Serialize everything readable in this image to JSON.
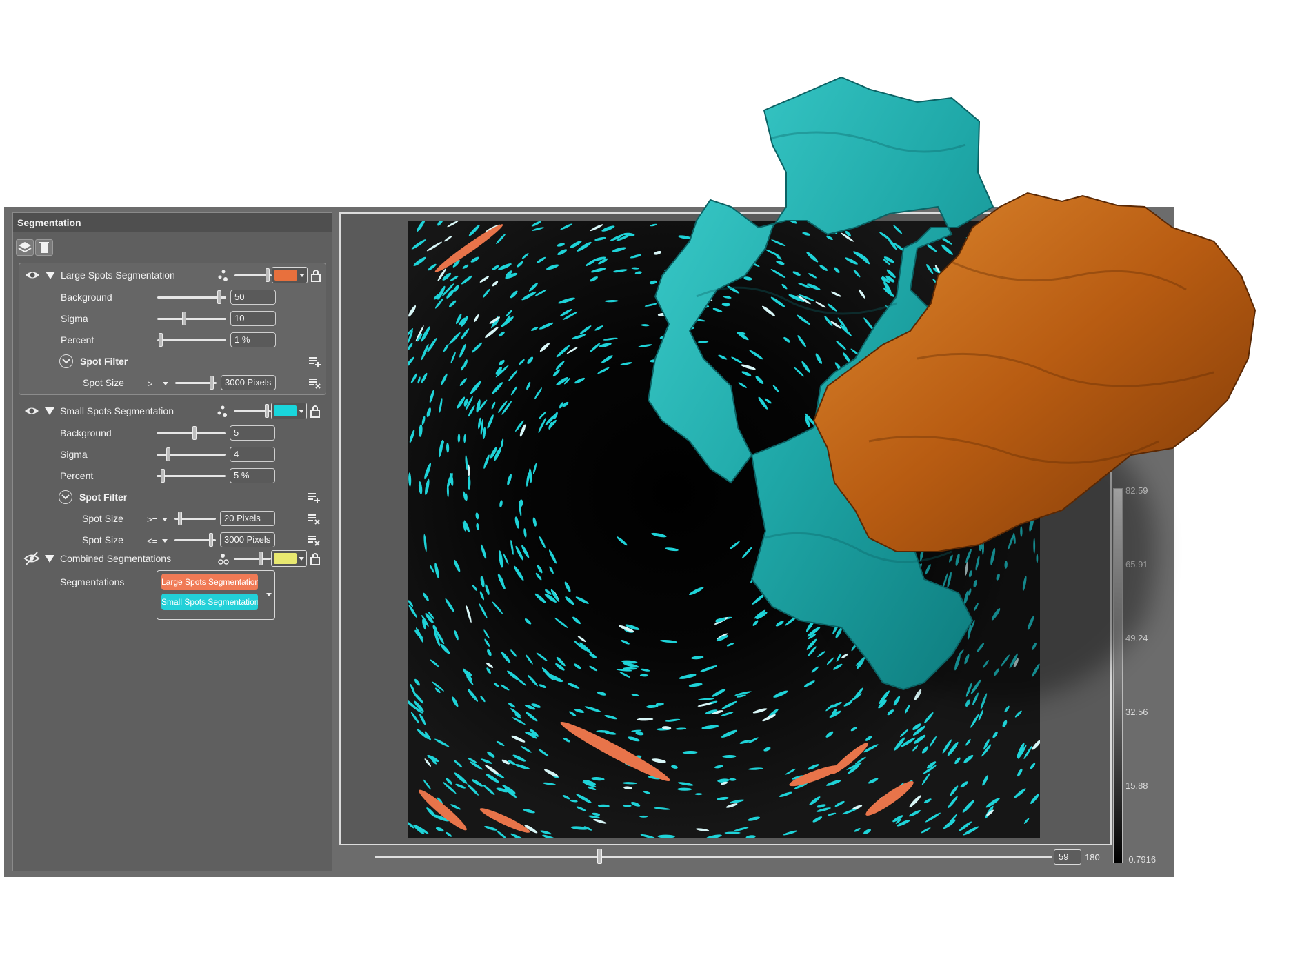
{
  "panel": {
    "title": "Segmentation",
    "toolbar": {
      "icons": [
        "layers-icon",
        "delete-icon"
      ]
    },
    "large": {
      "name": "Large Spots Segmentation",
      "color": "#e8703d",
      "params": [
        {
          "label": "Background",
          "value": "50",
          "level": 0.93
        },
        {
          "label": "Sigma",
          "value": "10",
          "level": 0.38
        },
        {
          "label": "Percent",
          "value": "1 %",
          "level": 0.02
        }
      ],
      "filter_label": "Spot Filter",
      "filters": [
        {
          "label": "Spot Size",
          "op": ">=",
          "value": "3000 Pixels",
          "level": 0.93
        }
      ]
    },
    "small": {
      "name": "Small Spots Segmentation",
      "color": "#19d6dc",
      "params": [
        {
          "label": "Background",
          "value": "5",
          "level": 0.55
        },
        {
          "label": "Sigma",
          "value": "4",
          "level": 0.15
        },
        {
          "label": "Percent",
          "value": "5 %",
          "level": 0.06
        }
      ],
      "filter_label": "Spot Filter",
      "filters": [
        {
          "label": "Spot Size",
          "op": ">=",
          "value": "20 Pixels",
          "level": 0.1
        },
        {
          "label": "Spot Size",
          "op": "<=",
          "value": "3000 Pixels",
          "level": 0.93
        }
      ]
    },
    "combined": {
      "name": "Combined Segmentations",
      "color": "#e8e870",
      "seg_label": "Segmentations",
      "items": [
        {
          "label": "Large Spots Segmentation",
          "color": "#f07a55"
        },
        {
          "label": "Small Spots Segmentation",
          "color": "#22d0d8"
        }
      ]
    }
  },
  "viewer": {
    "slice_value": "59",
    "slice_max": "180",
    "slice_level": 0.33,
    "colormap_ticks": [
      "82.59",
      "65.91",
      "49.24",
      "32.56",
      "15.88",
      "-0.7916"
    ]
  }
}
